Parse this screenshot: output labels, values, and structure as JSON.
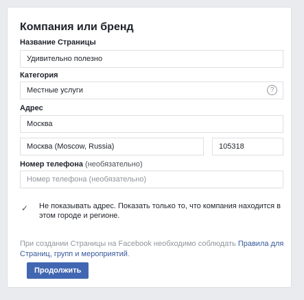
{
  "form": {
    "title": "Компания или бренд",
    "page_name": {
      "label": "Название Страницы",
      "value": "Удивительно полезно"
    },
    "category": {
      "label": "Категория",
      "value": "Местные услуги",
      "help_icon": "question-circle-icon"
    },
    "address": {
      "label": "Адрес",
      "street_value": "Москва",
      "city_value": "Москва (Moscow, Russia)",
      "zip_value": "105318"
    },
    "phone": {
      "label": "Номер телефона",
      "optional_suffix": "(необязательно)",
      "placeholder": "Номер телефона (необязательно)"
    },
    "hide_address": {
      "checked": true,
      "icon": "check-icon",
      "text": "Не показывать адрес. Показать только то, что компания находится в этом городе и регионе."
    },
    "terms": {
      "prefix": "При создании Страницы на Facebook необходимо соблюдать ",
      "link_text": "Правила для Страниц, групп и мероприятий",
      "suffix": "."
    },
    "continue_button": "Продолжить"
  },
  "colors": {
    "background": "#e9ebee",
    "card": "#ffffff",
    "button": "#4267b2",
    "link": "#365899",
    "muted_text": "#90949c"
  }
}
